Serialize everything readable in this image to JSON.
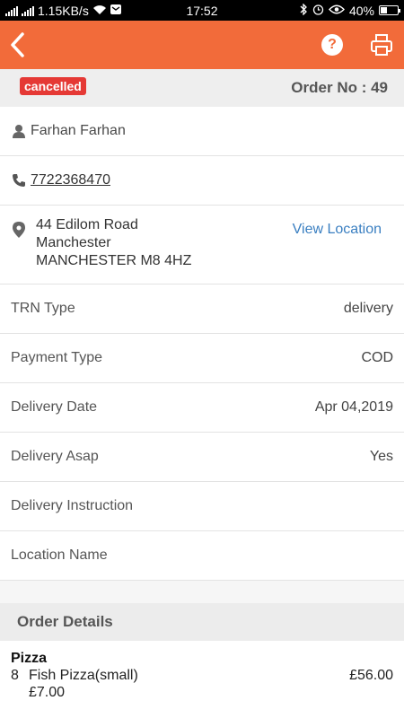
{
  "statusbar": {
    "network_speed": "1.15KB/s",
    "time": "17:52",
    "battery": "40%",
    "battery_level": 0.4
  },
  "appbar": {
    "icons": [
      "back-icon",
      "help-icon",
      "print-icon"
    ],
    "accent": "#f26b3a"
  },
  "order": {
    "status": "cancelled",
    "status_color": "#e53935",
    "order_no_label": "Order No : 49"
  },
  "customer": {
    "name": "Farhan Farhan",
    "phone": "7722368470",
    "address_line1": "44 Edilom Road",
    "address_line2": "Manchester",
    "address_line3": "MANCHESTER M8 4HZ",
    "view_location": "View Location"
  },
  "details": [
    {
      "label": "TRN Type",
      "value": "delivery"
    },
    {
      "label": "Payment Type",
      "value": "COD"
    },
    {
      "label": "Delivery Date",
      "value": "Apr 04,2019"
    },
    {
      "label": "Delivery Asap",
      "value": "Yes"
    },
    {
      "label": "Delivery Instruction",
      "value": ""
    },
    {
      "label": "Location Name",
      "value": ""
    }
  ],
  "order_details": {
    "heading": "Order Details",
    "category": "Pizza",
    "items": [
      {
        "qty": "8",
        "name": "Fish Pizza(small)",
        "total": "£56.00",
        "unit_price": "£7.00"
      }
    ]
  }
}
